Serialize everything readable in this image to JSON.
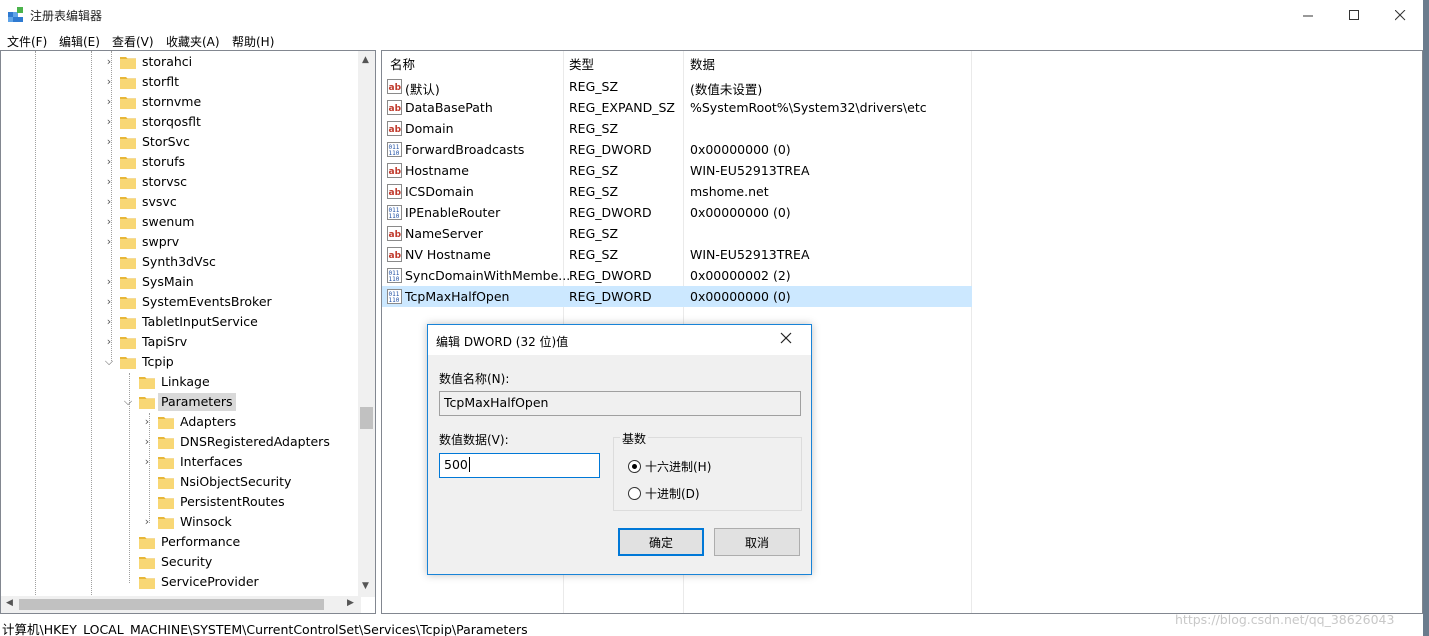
{
  "window": {
    "title": "注册表编辑器"
  },
  "menu": [
    "文件(F)",
    "编辑(E)",
    "查看(V)",
    "收藏夹(A)",
    "帮助(H)"
  ],
  "tree": {
    "items": [
      {
        "label": "storahci",
        "expander": "collapsed"
      },
      {
        "label": "storflt",
        "expander": "collapsed"
      },
      {
        "label": "stornvme",
        "expander": "collapsed"
      },
      {
        "label": "storqosflt",
        "expander": "collapsed"
      },
      {
        "label": "StorSvc",
        "expander": "collapsed"
      },
      {
        "label": "storufs",
        "expander": "collapsed"
      },
      {
        "label": "storvsc",
        "expander": "collapsed"
      },
      {
        "label": "svsvc",
        "expander": "collapsed"
      },
      {
        "label": "swenum",
        "expander": "collapsed"
      },
      {
        "label": "swprv",
        "expander": "collapsed"
      },
      {
        "label": "Synth3dVsc",
        "expander": "none"
      },
      {
        "label": "SysMain",
        "expander": "collapsed"
      },
      {
        "label": "SystemEventsBroker",
        "expander": "collapsed"
      },
      {
        "label": "TabletInputService",
        "expander": "collapsed"
      },
      {
        "label": "TapiSrv",
        "expander": "collapsed"
      },
      {
        "label": "Tcpip",
        "expander": "expanded"
      },
      {
        "label": "Linkage",
        "expander": "none"
      },
      {
        "label": "Parameters",
        "expander": "expanded",
        "selected": true
      },
      {
        "label": "Adapters",
        "expander": "collapsed"
      },
      {
        "label": "DNSRegisteredAdapters",
        "expander": "collapsed"
      },
      {
        "label": "Interfaces",
        "expander": "collapsed"
      },
      {
        "label": "NsiObjectSecurity",
        "expander": "none"
      },
      {
        "label": "PersistentRoutes",
        "expander": "none"
      },
      {
        "label": "Winsock",
        "expander": "collapsed"
      },
      {
        "label": "Performance",
        "expander": "none"
      },
      {
        "label": "Security",
        "expander": "none"
      },
      {
        "label": "ServiceProvider",
        "expander": "none"
      }
    ]
  },
  "list": {
    "headers": {
      "name": "名称",
      "type": "类型",
      "data": "数据"
    },
    "rows": [
      {
        "icon": "string-value-icon",
        "name": "(默认)",
        "type": "REG_SZ",
        "data": "(数值未设置)"
      },
      {
        "icon": "string-value-icon",
        "name": "DataBasePath",
        "type": "REG_EXPAND_SZ",
        "data": "%SystemRoot%\\System32\\drivers\\etc"
      },
      {
        "icon": "string-value-icon",
        "name": "Domain",
        "type": "REG_SZ",
        "data": ""
      },
      {
        "icon": "binary-value-icon",
        "name": "ForwardBroadcasts",
        "type": "REG_DWORD",
        "data": "0x00000000 (0)"
      },
      {
        "icon": "string-value-icon",
        "name": "Hostname",
        "type": "REG_SZ",
        "data": "WIN-EU52913TREA"
      },
      {
        "icon": "string-value-icon",
        "name": "ICSDomain",
        "type": "REG_SZ",
        "data": "mshome.net"
      },
      {
        "icon": "binary-value-icon",
        "name": "IPEnableRouter",
        "type": "REG_DWORD",
        "data": "0x00000000 (0)"
      },
      {
        "icon": "string-value-icon",
        "name": "NameServer",
        "type": "REG_SZ",
        "data": ""
      },
      {
        "icon": "string-value-icon",
        "name": "NV Hostname",
        "type": "REG_SZ",
        "data": "WIN-EU52913TREA"
      },
      {
        "icon": "binary-value-icon",
        "name": "SyncDomainWithMembe...",
        "type": "REG_DWORD",
        "data": "0x00000002 (2)"
      },
      {
        "icon": "binary-value-icon",
        "name": "TcpMaxHalfOpen",
        "type": "REG_DWORD",
        "data": "0x00000000 (0)",
        "selected": true
      }
    ]
  },
  "dialog": {
    "title": "编辑 DWORD (32 位)值",
    "name_label": "数值名称(N):",
    "name_value": "TcpMaxHalfOpen",
    "data_label": "数值数据(V):",
    "data_value": "500",
    "base_label": "基数",
    "hex_label": "十六进制(H)",
    "dec_label": "十进制(D)",
    "selected_base": "hex",
    "ok_label": "确定",
    "cancel_label": "取消"
  },
  "status": {
    "path": "计算机\\HKEY_LOCAL_MACHINE\\SYSTEM\\CurrentControlSet\\Services\\Tcpip\\Parameters",
    "watermark": "https://blog.csdn.net/qq_38626043"
  },
  "colors": {
    "selection": "#cce8ff",
    "accent": "#0078d7",
    "folder": "#f8d775"
  }
}
